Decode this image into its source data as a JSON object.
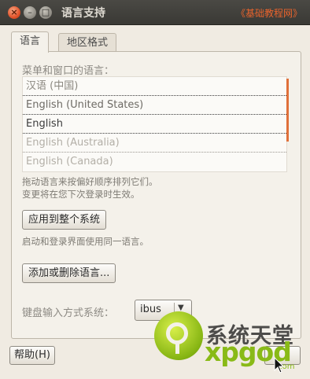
{
  "window": {
    "title": "语言支持",
    "watermark_top": "《基础教程网》",
    "controls": {
      "close": "×",
      "minimize": "–",
      "maximize": "□"
    }
  },
  "tabs": [
    {
      "label": "语言",
      "active": true
    },
    {
      "label": "地区格式",
      "active": false
    }
  ],
  "language_section": {
    "label": "菜单和窗口的语言：",
    "languages": [
      "汉语 (中国)",
      "English (United States)",
      "English",
      "English (Australia)",
      "English (Canada)"
    ],
    "drag_hint_line1": "拖动语言来按偏好顺序排列它们。",
    "drag_hint_line2": "变更将在您下次登录时生效。",
    "apply_button": "应用到整个系统",
    "apply_hint": "启动和登录界面使用同一语言。",
    "install_button": "添加或删除语言..."
  },
  "input_method": {
    "label": "键盘输入方式系统：",
    "value": "ibus",
    "arrow_icon": "dropdown-arrow-icon"
  },
  "footer": {
    "help_button": "帮助(H)"
  },
  "watermark": {
    "cn": "系统天堂",
    "en": "xpgod",
    "com": ".com"
  },
  "colors": {
    "accent": "#e0703a",
    "watermark_green": "#89ba17"
  }
}
